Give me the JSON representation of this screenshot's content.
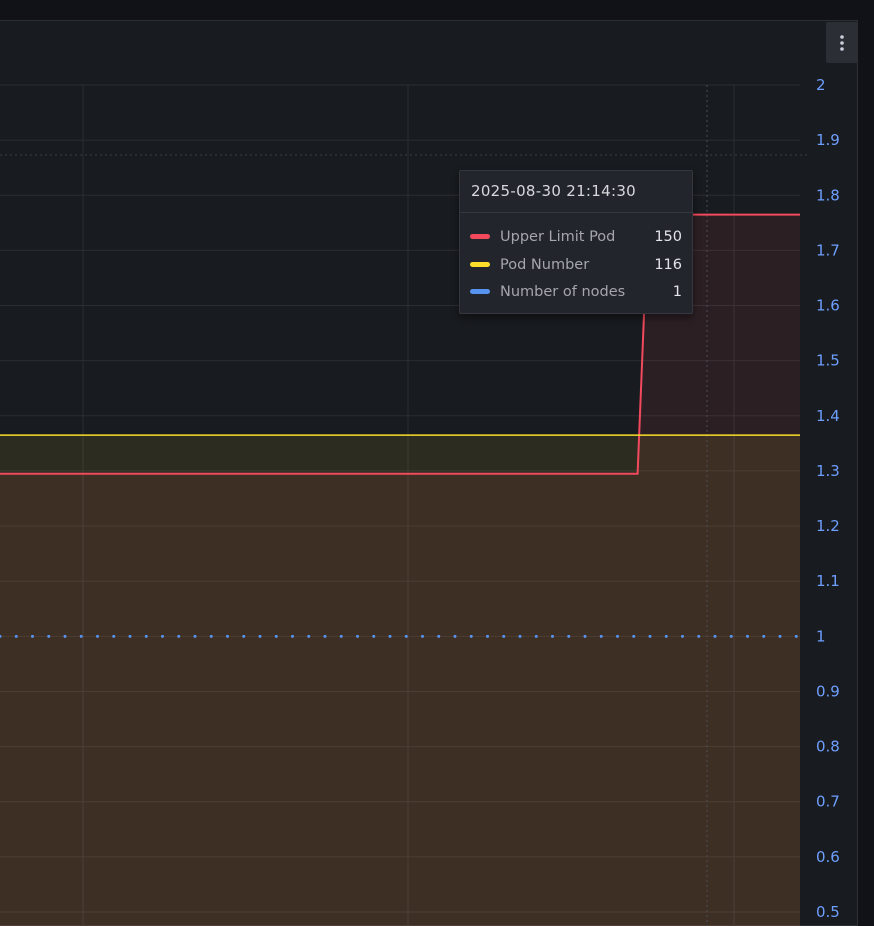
{
  "chart_data": {
    "type": "line",
    "y_axis": {
      "position": "right",
      "min": 0.5,
      "max": 2,
      "ticks": [
        "0.5",
        "0.6",
        "0.7",
        "0.8",
        "0.9",
        "1",
        "1.1",
        "1.2",
        "1.3",
        "1.4",
        "1.5",
        "1.6",
        "1.7",
        "1.8",
        "1.9",
        "2"
      ]
    },
    "grid": true,
    "series": [
      {
        "name": "Upper Limit Pod",
        "color": "#f2495c",
        "style": "solid",
        "fill": true,
        "points": [
          {
            "x": 0.0,
            "y": 1.295
          },
          {
            "x": 0.797,
            "y": 1.295
          },
          {
            "x": 0.81,
            "y": 1.765
          },
          {
            "x": 1.0,
            "y": 1.765
          }
        ]
      },
      {
        "name": "Pod Number",
        "color": "#fade2a",
        "style": "solid",
        "fill": true,
        "points": [
          {
            "x": 0.0,
            "y": 1.365
          },
          {
            "x": 1.0,
            "y": 1.365
          }
        ]
      },
      {
        "name": "Number of nodes",
        "color": "#5794f2",
        "style": "dotted",
        "fill": false,
        "points": [
          {
            "x": 0.0,
            "y": 1
          },
          {
            "x": 1.0,
            "y": 1
          }
        ]
      }
    ],
    "threshold_dotted_y": 1.873
  },
  "tooltip": {
    "time": "2025-08-30 21:14:30",
    "rows": [
      {
        "label": "Upper Limit Pod",
        "value": "150",
        "color": "#f2495c"
      },
      {
        "label": "Pod Number",
        "value": "116",
        "color": "#fade2a"
      },
      {
        "label": "Number of nodes",
        "value": "1",
        "color": "#5794f2"
      }
    ]
  },
  "menu_icon": "kebab-menu-icon"
}
